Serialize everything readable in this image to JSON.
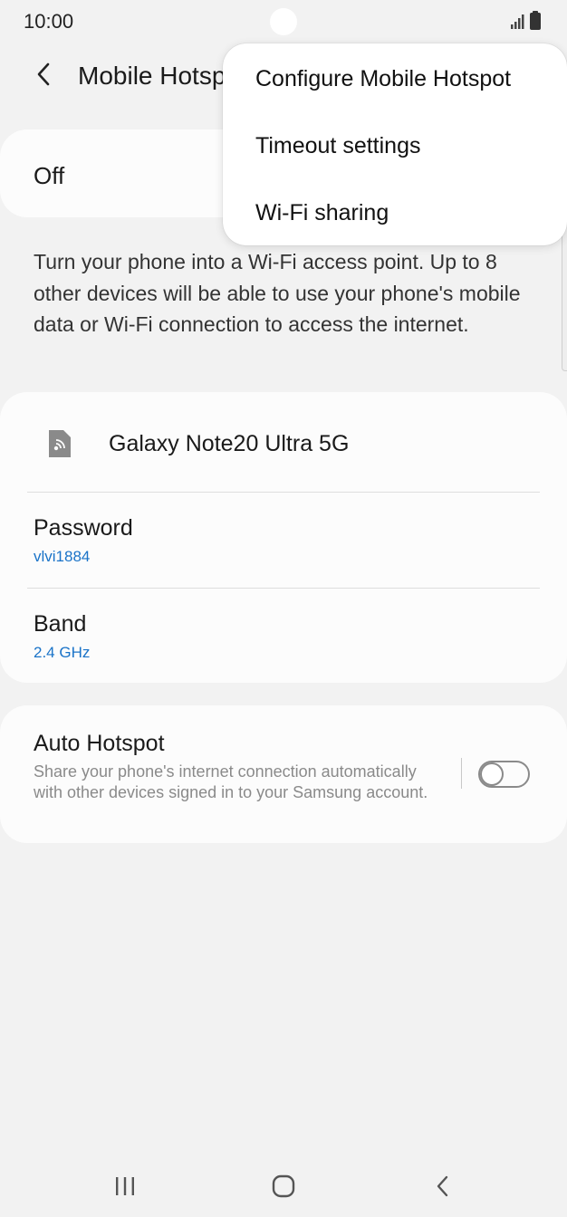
{
  "status_bar": {
    "time": "10:00"
  },
  "header": {
    "title": "Mobile Hotspot"
  },
  "hotspot": {
    "state_label": "Off",
    "enabled": false
  },
  "description": "Turn your phone into a Wi-Fi access point. Up to 8 other devices will be able to use your phone's mobile data or Wi-Fi connection to access the internet.",
  "network": {
    "device_name": "Galaxy Note20 Ultra 5G",
    "password_label": "Password",
    "password_value": "vlvi1884",
    "band_label": "Band",
    "band_value": "2.4 GHz"
  },
  "auto_hotspot": {
    "title": "Auto Hotspot",
    "description": "Share your phone's internet connection automatically with other devices signed in to your Samsung account.",
    "enabled": false
  },
  "menu": {
    "items": [
      {
        "label": "Configure Mobile Hotspot"
      },
      {
        "label": "Timeout settings"
      },
      {
        "label": "Wi-Fi sharing"
      }
    ]
  },
  "colors": {
    "background": "#f2f2f2",
    "card": "#fcfcfc",
    "accent_value": "#1a73c8",
    "secondary_text": "#8a8a8a"
  },
  "icons": {
    "signal": "signal-icon",
    "battery": "battery-icon",
    "back": "back-arrow-icon",
    "device": "hotspot-device-icon",
    "recents": "recents-icon",
    "home": "home-icon",
    "nav_back": "nav-back-icon"
  }
}
